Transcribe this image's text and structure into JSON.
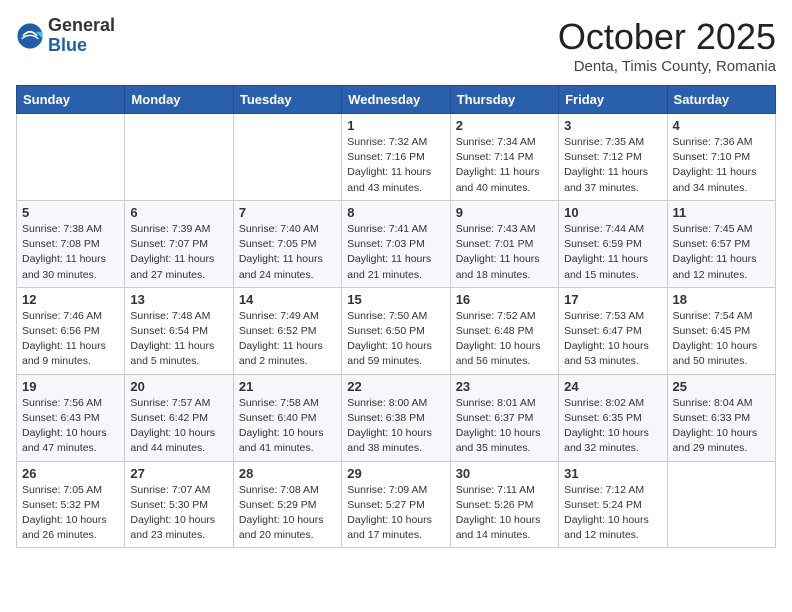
{
  "logo": {
    "general": "General",
    "blue": "Blue"
  },
  "header": {
    "month": "October 2025",
    "location": "Denta, Timis County, Romania"
  },
  "weekdays": [
    "Sunday",
    "Monday",
    "Tuesday",
    "Wednesday",
    "Thursday",
    "Friday",
    "Saturday"
  ],
  "weeks": [
    [
      {
        "day": "",
        "info": ""
      },
      {
        "day": "",
        "info": ""
      },
      {
        "day": "",
        "info": ""
      },
      {
        "day": "1",
        "info": "Sunrise: 7:32 AM\nSunset: 7:16 PM\nDaylight: 11 hours\nand 43 minutes."
      },
      {
        "day": "2",
        "info": "Sunrise: 7:34 AM\nSunset: 7:14 PM\nDaylight: 11 hours\nand 40 minutes."
      },
      {
        "day": "3",
        "info": "Sunrise: 7:35 AM\nSunset: 7:12 PM\nDaylight: 11 hours\nand 37 minutes."
      },
      {
        "day": "4",
        "info": "Sunrise: 7:36 AM\nSunset: 7:10 PM\nDaylight: 11 hours\nand 34 minutes."
      }
    ],
    [
      {
        "day": "5",
        "info": "Sunrise: 7:38 AM\nSunset: 7:08 PM\nDaylight: 11 hours\nand 30 minutes."
      },
      {
        "day": "6",
        "info": "Sunrise: 7:39 AM\nSunset: 7:07 PM\nDaylight: 11 hours\nand 27 minutes."
      },
      {
        "day": "7",
        "info": "Sunrise: 7:40 AM\nSunset: 7:05 PM\nDaylight: 11 hours\nand 24 minutes."
      },
      {
        "day": "8",
        "info": "Sunrise: 7:41 AM\nSunset: 7:03 PM\nDaylight: 11 hours\nand 21 minutes."
      },
      {
        "day": "9",
        "info": "Sunrise: 7:43 AM\nSunset: 7:01 PM\nDaylight: 11 hours\nand 18 minutes."
      },
      {
        "day": "10",
        "info": "Sunrise: 7:44 AM\nSunset: 6:59 PM\nDaylight: 11 hours\nand 15 minutes."
      },
      {
        "day": "11",
        "info": "Sunrise: 7:45 AM\nSunset: 6:57 PM\nDaylight: 11 hours\nand 12 minutes."
      }
    ],
    [
      {
        "day": "12",
        "info": "Sunrise: 7:46 AM\nSunset: 6:56 PM\nDaylight: 11 hours\nand 9 minutes."
      },
      {
        "day": "13",
        "info": "Sunrise: 7:48 AM\nSunset: 6:54 PM\nDaylight: 11 hours\nand 5 minutes."
      },
      {
        "day": "14",
        "info": "Sunrise: 7:49 AM\nSunset: 6:52 PM\nDaylight: 11 hours\nand 2 minutes."
      },
      {
        "day": "15",
        "info": "Sunrise: 7:50 AM\nSunset: 6:50 PM\nDaylight: 10 hours\nand 59 minutes."
      },
      {
        "day": "16",
        "info": "Sunrise: 7:52 AM\nSunset: 6:48 PM\nDaylight: 10 hours\nand 56 minutes."
      },
      {
        "day": "17",
        "info": "Sunrise: 7:53 AM\nSunset: 6:47 PM\nDaylight: 10 hours\nand 53 minutes."
      },
      {
        "day": "18",
        "info": "Sunrise: 7:54 AM\nSunset: 6:45 PM\nDaylight: 10 hours\nand 50 minutes."
      }
    ],
    [
      {
        "day": "19",
        "info": "Sunrise: 7:56 AM\nSunset: 6:43 PM\nDaylight: 10 hours\nand 47 minutes."
      },
      {
        "day": "20",
        "info": "Sunrise: 7:57 AM\nSunset: 6:42 PM\nDaylight: 10 hours\nand 44 minutes."
      },
      {
        "day": "21",
        "info": "Sunrise: 7:58 AM\nSunset: 6:40 PM\nDaylight: 10 hours\nand 41 minutes."
      },
      {
        "day": "22",
        "info": "Sunrise: 8:00 AM\nSunset: 6:38 PM\nDaylight: 10 hours\nand 38 minutes."
      },
      {
        "day": "23",
        "info": "Sunrise: 8:01 AM\nSunset: 6:37 PM\nDaylight: 10 hours\nand 35 minutes."
      },
      {
        "day": "24",
        "info": "Sunrise: 8:02 AM\nSunset: 6:35 PM\nDaylight: 10 hours\nand 32 minutes."
      },
      {
        "day": "25",
        "info": "Sunrise: 8:04 AM\nSunset: 6:33 PM\nDaylight: 10 hours\nand 29 minutes."
      }
    ],
    [
      {
        "day": "26",
        "info": "Sunrise: 7:05 AM\nSunset: 5:32 PM\nDaylight: 10 hours\nand 26 minutes."
      },
      {
        "day": "27",
        "info": "Sunrise: 7:07 AM\nSunset: 5:30 PM\nDaylight: 10 hours\nand 23 minutes."
      },
      {
        "day": "28",
        "info": "Sunrise: 7:08 AM\nSunset: 5:29 PM\nDaylight: 10 hours\nand 20 minutes."
      },
      {
        "day": "29",
        "info": "Sunrise: 7:09 AM\nSunset: 5:27 PM\nDaylight: 10 hours\nand 17 minutes."
      },
      {
        "day": "30",
        "info": "Sunrise: 7:11 AM\nSunset: 5:26 PM\nDaylight: 10 hours\nand 14 minutes."
      },
      {
        "day": "31",
        "info": "Sunrise: 7:12 AM\nSunset: 5:24 PM\nDaylight: 10 hours\nand 12 minutes."
      },
      {
        "day": "",
        "info": ""
      }
    ]
  ]
}
